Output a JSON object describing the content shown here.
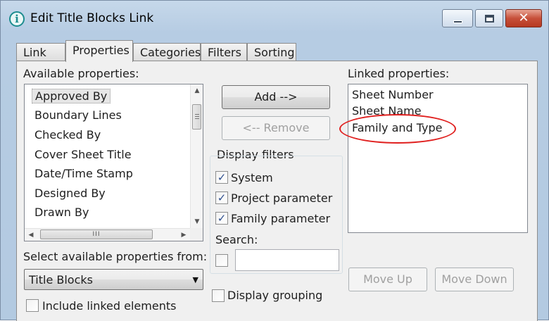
{
  "window": {
    "title": "Edit Title Blocks Link",
    "app_icon_glyph": "i",
    "close_glyph": "✕"
  },
  "tabs": [
    {
      "label": "Link",
      "active": false
    },
    {
      "label": "Properties",
      "active": true
    },
    {
      "label": "Categories",
      "active": false
    },
    {
      "label": "Filters",
      "active": false
    },
    {
      "label": "Sorting",
      "active": false
    }
  ],
  "available": {
    "label": "Available properties:",
    "items": [
      "Approved By",
      "Boundary Lines",
      "Checked By",
      "Cover Sheet Title",
      "Date/Time Stamp",
      "Designed By",
      "Drawn By"
    ],
    "selected_index": 0,
    "hscroll_grip": "III"
  },
  "buttons": {
    "add": "Add -->",
    "remove": "<-- Remove",
    "move_up": "Move Up",
    "move_down": "Move Down"
  },
  "display_filters": {
    "title": "Display filters",
    "options": [
      {
        "label": "System",
        "checked": true
      },
      {
        "label": "Project parameter",
        "checked": true
      },
      {
        "label": "Family parameter",
        "checked": true
      }
    ],
    "search_label": "Search:",
    "search_value": ""
  },
  "linked": {
    "label": "Linked properties:",
    "items": [
      "Sheet Number",
      "Sheet Name",
      "Family and Type"
    ]
  },
  "source_select": {
    "label": "Select available properties from:",
    "value": "Title Blocks"
  },
  "display_grouping": {
    "label": "Display grouping",
    "checked": false
  },
  "include_linked": {
    "label": "Include linked elements",
    "checked": false
  },
  "checkmark_glyph": "✓",
  "colors": {
    "annotation_oval": "#e0201f",
    "title_bar": "#b6cce3",
    "close_button": "#c7503a"
  }
}
